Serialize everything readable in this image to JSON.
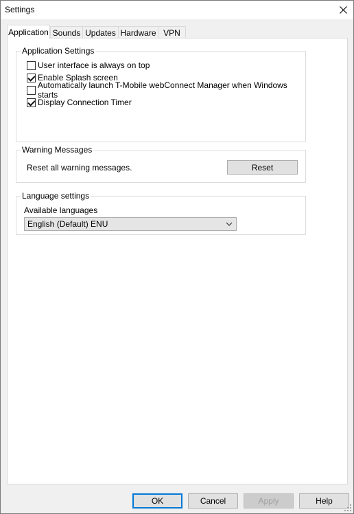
{
  "window": {
    "title": "Settings"
  },
  "tabs": [
    {
      "label": "Application"
    },
    {
      "label": "Sounds"
    },
    {
      "label": "Updates"
    },
    {
      "label": "Hardware"
    },
    {
      "label": "VPN"
    }
  ],
  "app_settings": {
    "legend": "Application Settings",
    "options": [
      {
        "label": "User interface is always on top",
        "checked": false
      },
      {
        "label": "Enable Splash screen",
        "checked": true
      },
      {
        "label": "Automatically launch T-Mobile webConnect Manager when Windows starts",
        "checked": false
      },
      {
        "label": "Display Connection Timer",
        "checked": true
      }
    ]
  },
  "warning": {
    "legend": "Warning Messages",
    "text": "Reset all warning messages.",
    "reset_label": "Reset"
  },
  "language": {
    "legend": "Language settings",
    "label": "Available languages",
    "selected": "English (Default) ENU"
  },
  "buttons": {
    "ok": "OK",
    "cancel": "Cancel",
    "apply": "Apply",
    "help": "Help"
  }
}
